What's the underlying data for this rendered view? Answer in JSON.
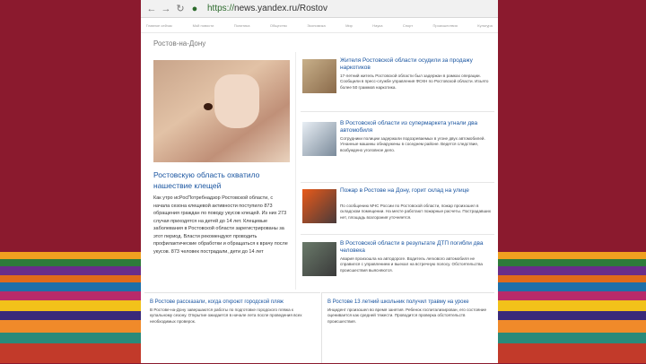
{
  "browser": {
    "url_protocol": "https://",
    "url_domain": "news.yandex.ru",
    "url_path": "/Rostov"
  },
  "topnav": [
    "Главное сейчас",
    "Мой новости",
    "Политика",
    "Общество",
    "Экономика",
    "Мир",
    "Наука",
    "Спорт",
    "Происшествия",
    "Культура"
  ],
  "crumb": "Ростов-на-Дону",
  "main": {
    "title": "Ростовскую область охватило нашествие клещей",
    "text": "Как утро исРосПотребнадзор Ростовской области, с начала сезона клещевой активности поступило 873 обращения граждан по поводу укусов клещей. Из них 273 случая приходятся на детей до 14 лет. Клещевые заболевания в Ростовской области зарегистрированы за этот период. Власти рекомендуют проводить профилактические обработки и обращаться к врачу после укусов. 873 человек пострадали, дети до 14 лет"
  },
  "items": [
    {
      "title": "Жителя Ростовской области осудили за продажу наркотиков",
      "text": "17-летний житель Ростовской области был задержан в рамках операции. Сообщили в пресс-службе управления ФСКН по Ростовской области. Изъято более 50 граммов наркотика.",
      "pic": "photo-substance"
    },
    {
      "title": "В Ростовской области из супермаркета угнали два автомобиля",
      "text": "Сотрудники полиции задержали подозреваемых в угоне двух автомобилей. Угнанные машины обнаружены в соседнем районе. Ведется следствие, возбуждено уголовное дело.",
      "pic": "photo-police-car"
    },
    {
      "title": "Пожар в Ростове на Дону, горит склад на улице",
      "text": "По сообщению МЧС России по Ростовской области, пожар произошел в складском помещении. На месте работают пожарные расчеты. Пострадавших нет, площадь возгорания уточняется.",
      "pic": "photo-fire"
    },
    {
      "title": "В Ростовской области в результате ДТП погибли два человека",
      "text": "Авария произошла на автодороге. Водитель легкового автомобиля не справился с управлением и выехал на встречную полосу. Обстоятельства происшествия выясняются.",
      "pic": "photo-accident"
    }
  ],
  "bottom": [
    {
      "title": "В Ростове рассказали, когда откроют городской пляж",
      "text": "В Ростове-на-Дону завершаются работы по подготовке городского пляжа к купальному сезону. Открытие ожидается в начале лета после проведения всех необходимых проверок."
    },
    {
      "title": "В Ростове 13 летний школьник получил травму на уроке",
      "text": "Инцидент произошел во время занятия. Ребенок госпитализирован, его состояние оценивается как средней тяжести. Проводится проверка обстоятельств происшествия."
    }
  ],
  "colors": {
    "background": "#8b1a2e",
    "link": "#1a55a0"
  }
}
